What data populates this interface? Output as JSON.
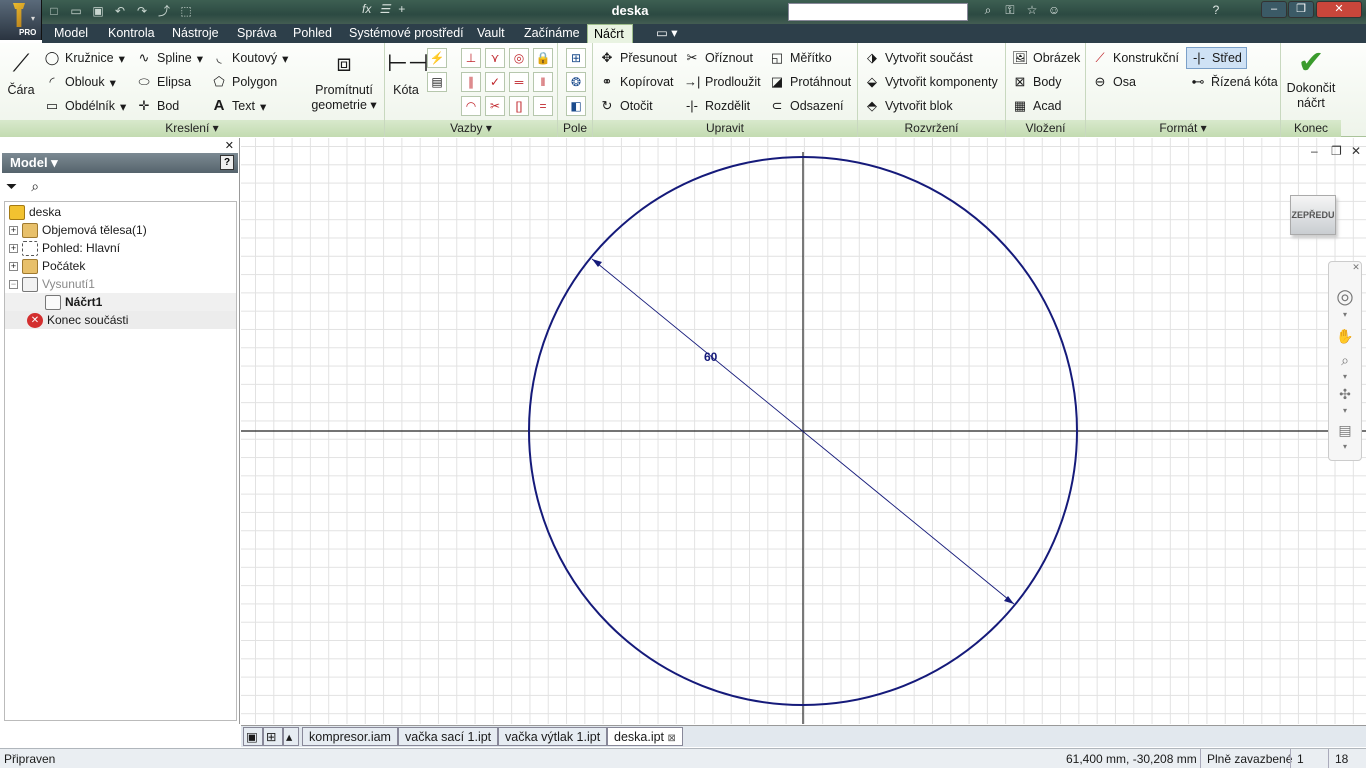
{
  "window": {
    "doc_title": "deska"
  },
  "tabs": [
    "Model",
    "Kontrola",
    "Nástroje",
    "Správa",
    "Pohled",
    "Systémové prostředí",
    "Vault",
    "Začínáme",
    "Náčrt"
  ],
  "active_tab": "Náčrt",
  "ribbon": {
    "kresleni": {
      "label": "Kreslení",
      "cara": "Čára",
      "kruznice": "Kružnice",
      "oblouk": "Oblouk",
      "obdelnik": "Obdélník",
      "spline": "Spline",
      "elipsa": "Elipsa",
      "bod": "Bod",
      "koutovy": "Koutový",
      "polygon": "Polygon",
      "text": "Text"
    },
    "promitnuti": {
      "line1": "Promítnutí",
      "line2": "geometrie"
    },
    "vazby": {
      "label": "Vazby",
      "kota": "Kóta"
    },
    "pole": {
      "label": "Pole"
    },
    "upravit": {
      "label": "Upravit",
      "presunout": "Přesunout",
      "kopirovat": "Kopírovat",
      "otocit": "Otočit",
      "oriznout": "Oříznout",
      "prodlouzit": "Prodloužit",
      "rozdelit": "Rozdělit",
      "meritko": "Měřítko",
      "protahnout": "Protáhnout",
      "odsazeni": "Odsazení"
    },
    "rozvrzeni": {
      "label": "Rozvržení",
      "soucast": "Vytvořit součást",
      "komponenty": "Vytvořit komponenty",
      "blok": "Vytvořit blok"
    },
    "vlozeni": {
      "label": "Vložení",
      "obrazek": "Obrázek",
      "body": "Body",
      "acad": "Acad"
    },
    "format": {
      "label": "Formát",
      "konstrukcni": "Konstrukční",
      "osa": "Osa",
      "stred": "Střed",
      "rizena_kota": "Řízená kóta"
    },
    "konec": {
      "label": "Konec",
      "line1": "Dokončit",
      "line2": "náčrt"
    }
  },
  "browser": {
    "title": "Model",
    "tree": [
      {
        "label": "deska"
      },
      {
        "label": "Objemová tělesa(1)"
      },
      {
        "label": "Pohled: Hlavní"
      },
      {
        "label": "Počátek"
      },
      {
        "label": "Vysunutí1"
      },
      {
        "label": "Náčrt1"
      },
      {
        "label": "Konec součásti"
      }
    ]
  },
  "sketch": {
    "dimension_label": "60",
    "viewcube_label": "ZEPŘEDU"
  },
  "document_tabs": [
    "kompresor.iam",
    "vačka sací 1.ipt",
    "vačka výtlak 1.ipt",
    "deska.ipt"
  ],
  "active_document": "deska.ipt",
  "status": {
    "left": "Připraven",
    "coords": "61,400 mm, -30,208 mm",
    "constraint": "Plně zavazbené",
    "count1": "1",
    "count2": "18"
  }
}
